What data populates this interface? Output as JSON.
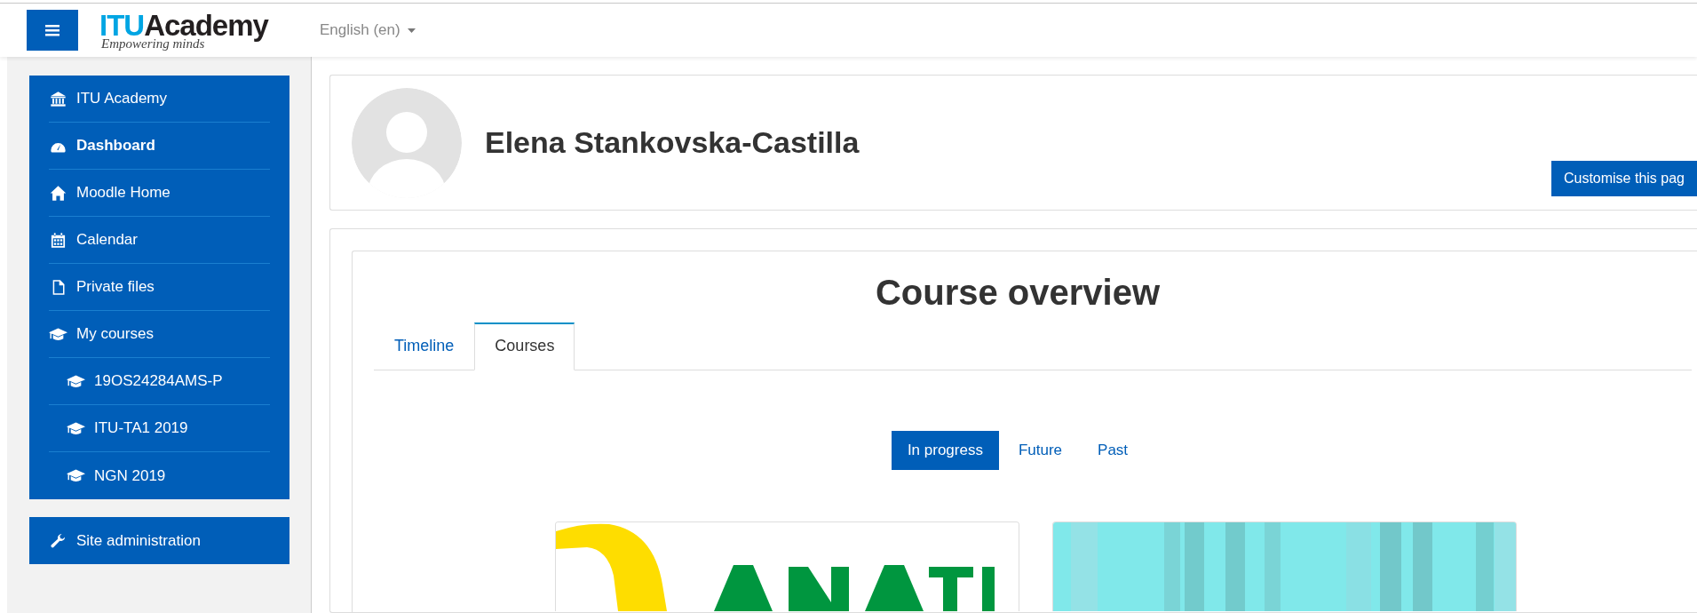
{
  "header": {
    "logo": {
      "brand_a": "ITU",
      "brand_b": "Academy",
      "tagline": "Empowering minds"
    },
    "language": "English (en)"
  },
  "sidebar": {
    "items": [
      {
        "label": "ITU Academy",
        "selected": false
      },
      {
        "label": "Dashboard",
        "selected": true
      },
      {
        "label": "Moodle Home",
        "selected": false
      },
      {
        "label": "Calendar",
        "selected": false
      },
      {
        "label": "Private files",
        "selected": false
      },
      {
        "label": "My courses",
        "selected": false,
        "children": [
          {
            "label": "19OS24284AMS-P",
            "selected": false
          },
          {
            "label": "ITU-TA1 2019",
            "selected": false
          },
          {
            "label": "NGN 2019",
            "selected": false
          }
        ]
      }
    ],
    "admin": {
      "label": "Site administration"
    }
  },
  "profile": {
    "name": "Elena Stankovska-Castilla",
    "button": "Customise this pag"
  },
  "course_overview": {
    "title": "Course overview",
    "tabs": [
      {
        "label": "Timeline",
        "selected": false
      },
      {
        "label": "Courses",
        "selected": true
      }
    ],
    "filters": [
      {
        "label": "In progress",
        "selected": true
      },
      {
        "label": "Future",
        "selected": false
      },
      {
        "label": "Past",
        "selected": false
      }
    ]
  }
}
